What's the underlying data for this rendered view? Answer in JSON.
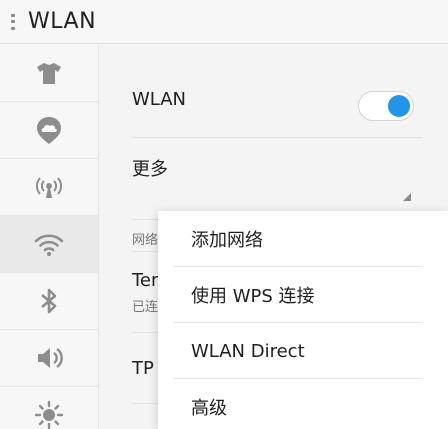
{
  "header": {
    "title": "WLAN"
  },
  "sidebar": {
    "items": [
      {
        "icon": "shirt-icon",
        "name": "sidebar-item-theme"
      },
      {
        "icon": "cloud-location-icon",
        "name": "sidebar-item-cloud"
      },
      {
        "icon": "wireless-broadcast-icon",
        "name": "sidebar-item-hotspot"
      },
      {
        "icon": "wifi-icon",
        "name": "sidebar-item-wlan",
        "active": true
      },
      {
        "icon": "bluetooth-icon",
        "name": "sidebar-item-bluetooth"
      },
      {
        "icon": "volume-icon",
        "name": "sidebar-item-sound"
      },
      {
        "icon": "brightness-icon",
        "name": "sidebar-item-display"
      }
    ]
  },
  "main": {
    "wlan_label": "WLAN",
    "wlan_enabled": true,
    "more_label": "更多",
    "section_label": "网络",
    "networks": [
      {
        "name": "Ter",
        "status": "已连"
      },
      {
        "name": "TP"
      }
    ]
  },
  "popup_menu": {
    "items": [
      "添加网络",
      "使用 WPS 连接",
      "WLAN Direct",
      "高级"
    ]
  },
  "colors": {
    "accent": "#2196e8",
    "icon": "#8d8d8d"
  }
}
